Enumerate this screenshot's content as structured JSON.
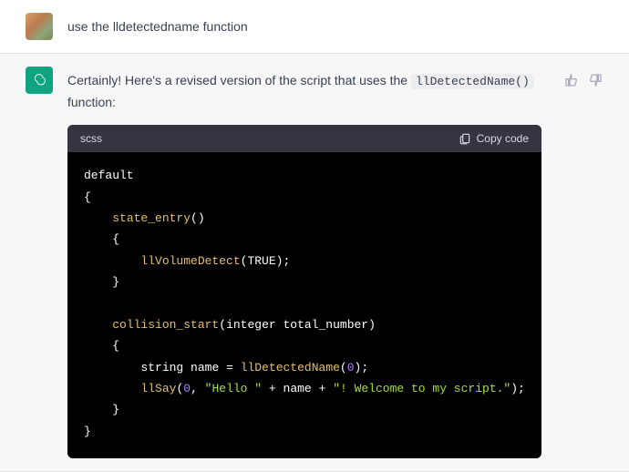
{
  "user": {
    "message": "use the lldetectedname function"
  },
  "assistant": {
    "intro_pre": "Certainly! Here's a revised version of the script that uses the ",
    "intro_code": "llDetectedName()",
    "intro_post": " function:",
    "code": {
      "lang": "scss",
      "copy_label": "Copy code",
      "tokens": {
        "default": "default",
        "state_entry": "state_entry",
        "llVolumeDetect": "llVolumeDetect",
        "TRUE": "TRUE",
        "collision_start": "collision_start",
        "integer": "integer",
        "total_number": "total_number",
        "string": "string",
        "name": "name",
        "eq": "=",
        "llDetectedName": "llDetectedName",
        "zero": "0",
        "zero2": "0",
        "llSay": "llSay",
        "str1": "\"Hello \"",
        "plus": "+",
        "plus2": "+",
        "str2": "\"! Welcome to my script.\""
      }
    }
  }
}
